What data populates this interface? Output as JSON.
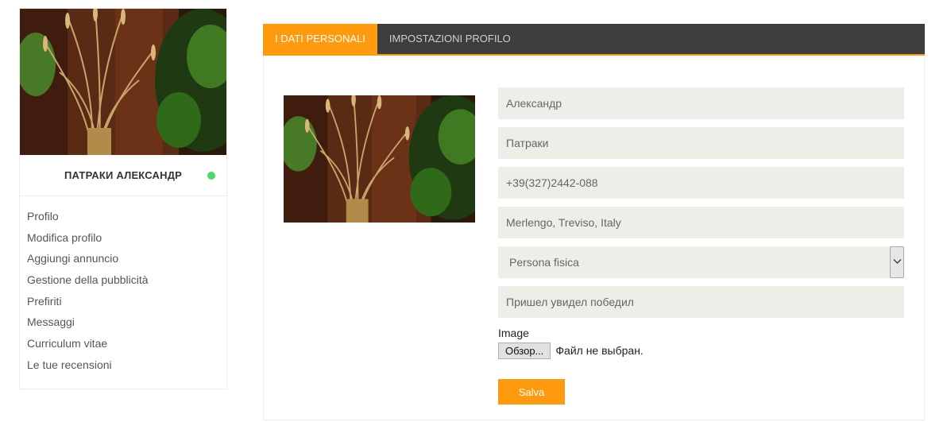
{
  "sidebar": {
    "user_name": "ПАТРАКИ АЛЕКСАНДР",
    "status_color": "#4cd964",
    "menu": [
      {
        "label": "Profilo"
      },
      {
        "label": "Modifica profilo"
      },
      {
        "label": "Aggiungi annuncio"
      },
      {
        "label": "Gestione della pubblicità"
      },
      {
        "label": "Prefiriti"
      },
      {
        "label": "Messaggi"
      },
      {
        "label": "Curriculum vitae"
      },
      {
        "label": "Le tue recensioni"
      }
    ]
  },
  "tabs": [
    {
      "label": "I DATI PERSONALI",
      "active": true
    },
    {
      "label": "IMPOSTAZIONI PROFILO",
      "active": false
    }
  ],
  "form": {
    "first_name": "Александр",
    "last_name": "Патраки",
    "phone": "+39(327)2442-088",
    "location": "Merlengo, Treviso, Italy",
    "person_type": "Persona fisica",
    "description": "Пришел увидел победил",
    "image_label": "Image",
    "browse_label": "Обзор...",
    "file_status": "Файл не выбран.",
    "save_label": "Salva"
  },
  "colors": {
    "accent": "#ff9a0e",
    "tab_bar": "#3d3d3d",
    "input_bg": "#efede8"
  }
}
